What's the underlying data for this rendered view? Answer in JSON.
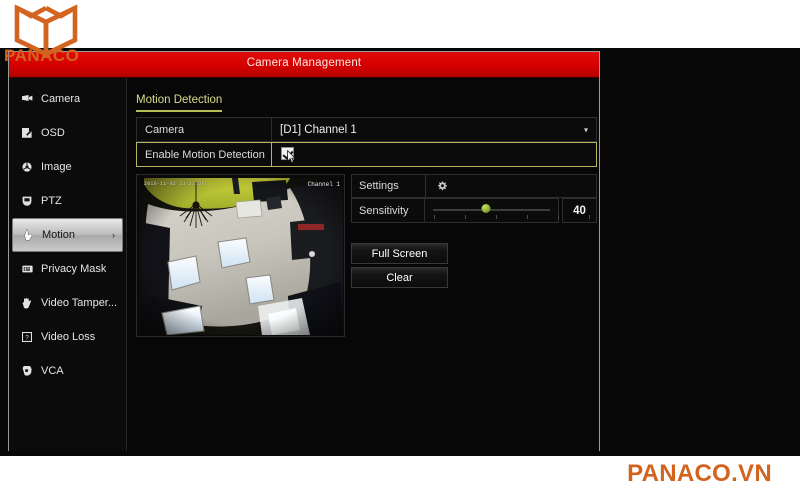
{
  "brand": {
    "logo_icon": "open-book-icon",
    "wordmark": "PANACO",
    "footer_watermark": "PANACO.VN",
    "accent_color": "#d2641f"
  },
  "window": {
    "title": "Camera Management",
    "titlebar_color": "#d40000"
  },
  "sidebar": {
    "items": [
      {
        "label": "Camera",
        "icon": "camera-icon",
        "selected": false,
        "has_chevron": false
      },
      {
        "label": "OSD",
        "icon": "osd-pencil-icon",
        "selected": false,
        "has_chevron": false
      },
      {
        "label": "Image",
        "icon": "image-circle-icon",
        "selected": false,
        "has_chevron": false
      },
      {
        "label": "PTZ",
        "icon": "ptz-icon",
        "selected": false,
        "has_chevron": false
      },
      {
        "label": "Motion",
        "icon": "motion-hand-icon",
        "selected": true,
        "has_chevron": true
      },
      {
        "label": "Privacy Mask",
        "icon": "privacy-mask-icon",
        "selected": false,
        "has_chevron": false
      },
      {
        "label": "Video Tamper...",
        "icon": "video-tamper-icon",
        "selected": false,
        "has_chevron": false
      },
      {
        "label": "Video Loss",
        "icon": "video-loss-icon",
        "selected": false,
        "has_chevron": false
      },
      {
        "label": "VCA",
        "icon": "vca-icon",
        "selected": false,
        "has_chevron": false
      }
    ],
    "chevron_glyph": "›"
  },
  "main": {
    "tab": {
      "label": "Motion Detection",
      "underline_color": "#b7be53"
    },
    "camera_row": {
      "label": "Camera",
      "value": "[D1] Channel 1",
      "dropdown_glyph": "▾"
    },
    "enable_row": {
      "label": "Enable Motion Detection",
      "checked": true,
      "highlight_color": "#b5b560",
      "cursor_icon": "mouse-pointer-icon"
    },
    "preview": {
      "overlay_timestamp": "2016-11-02 23:22:36",
      "overlay_channel": "Channel 1"
    },
    "settings_row": {
      "label": "Settings",
      "icon": "gear-icon"
    },
    "sensitivity_row": {
      "label": "Sensitivity",
      "value": "40",
      "min": 0,
      "max": 100,
      "thumb_color": "#86a82b",
      "tick_count": 6
    },
    "buttons": {
      "fullscreen": "Full Screen",
      "clear": "Clear"
    }
  }
}
